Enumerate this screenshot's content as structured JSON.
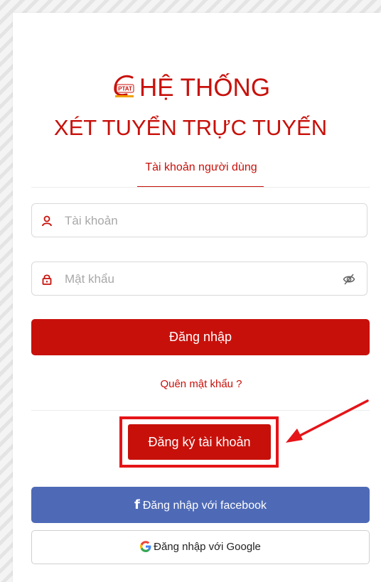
{
  "login": {
    "title_line1": "HỆ THỐNG",
    "title_line2": "XÉT TUYỂN TRỰC TUYẾN",
    "logo_text": "PTAT",
    "tab_label": "Tài khoản người dùng",
    "username_placeholder": "Tài khoản",
    "password_placeholder": "Mật khẩu",
    "login_button": "Đăng nhập",
    "forgot_password": "Quên mật khẩu ?",
    "register_button": "Đăng ký tài khoản",
    "facebook_button": "Đăng nhập với facebook",
    "google_button": "Đăng nhập với Google"
  },
  "icons": {
    "logo": "ptat-logo-icon",
    "user": "user-icon",
    "lock": "lock-icon",
    "eye": "eye-off-icon",
    "facebook": "facebook-icon",
    "google": "google-icon",
    "arrow": "annotation-arrow"
  },
  "colors": {
    "primary_red": "#c8100a",
    "facebook_blue": "#4e6ab7",
    "highlight_red": "#e51418"
  }
}
